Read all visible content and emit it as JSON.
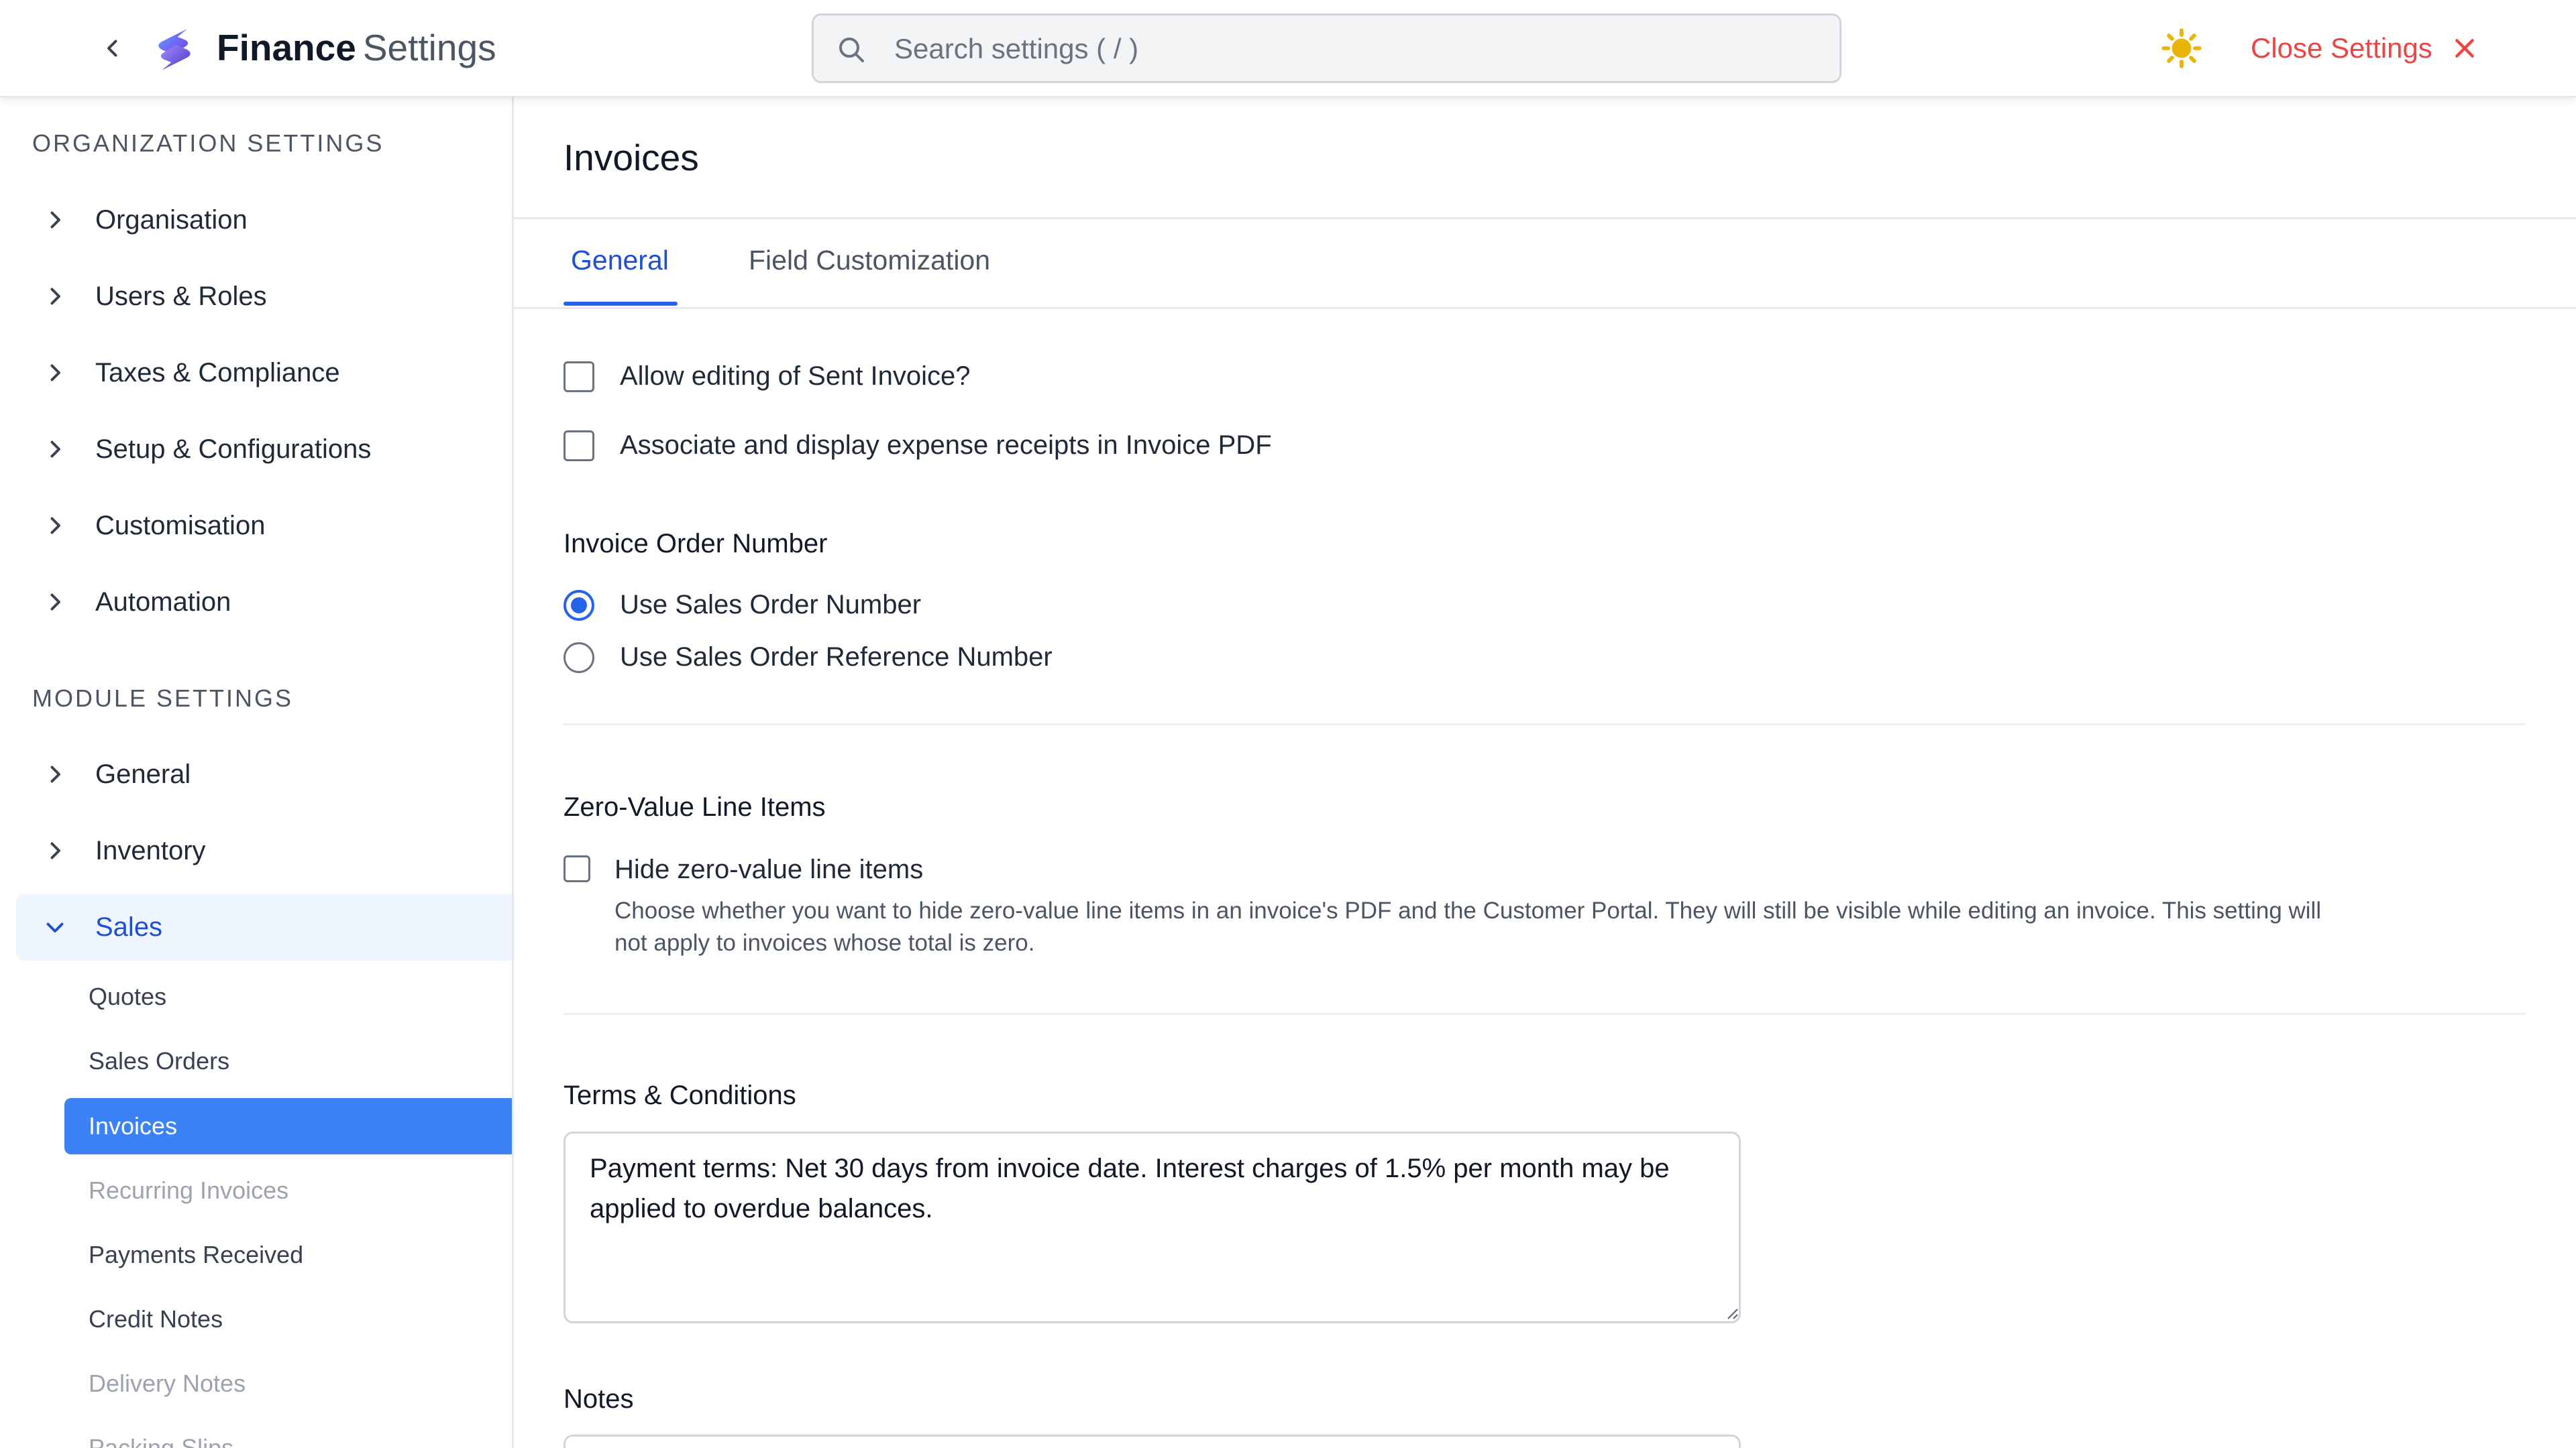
{
  "header": {
    "brand_strong": "Finance",
    "brand_light": "Settings",
    "search": {
      "placeholder": "Search settings ( / )",
      "value": ""
    },
    "close_label": "Close Settings",
    "icons": {
      "back": "chevron-left-icon",
      "logo": "app-logo-icon",
      "search": "search-icon",
      "theme": "sun-icon",
      "close": "close-icon"
    },
    "colors": {
      "close": "#ef4444",
      "sun": "#eab308",
      "accent": "#2563eb"
    }
  },
  "sidebar": {
    "org_section_label": "ORGANIZATION SETTINGS",
    "org_items": [
      {
        "label": "Organisation"
      },
      {
        "label": "Users & Roles"
      },
      {
        "label": "Taxes & Compliance"
      },
      {
        "label": "Setup & Configurations"
      },
      {
        "label": "Customisation"
      },
      {
        "label": "Automation"
      }
    ],
    "module_section_label": "MODULE SETTINGS",
    "module_items": [
      {
        "label": "General"
      },
      {
        "label": "Inventory"
      },
      {
        "label": "Sales",
        "expanded": true
      }
    ],
    "sales_sub_items": [
      {
        "label": "Quotes"
      },
      {
        "label": "Sales Orders"
      },
      {
        "label": "Invoices",
        "active": true
      },
      {
        "label": "Recurring Invoices",
        "disabled": true
      },
      {
        "label": "Payments Received"
      },
      {
        "label": "Credit Notes"
      },
      {
        "label": "Delivery Notes",
        "disabled": true
      },
      {
        "label": "Packing Slips",
        "disabled": true
      }
    ],
    "colors": {
      "active_bg": "#3b82f6",
      "expanded_bg": "#eff6ff"
    }
  },
  "main": {
    "page_title": "Invoices",
    "tabs": [
      {
        "label": "General",
        "active": true
      },
      {
        "label": "Field Customization"
      }
    ],
    "options": {
      "allow_editing_sent": {
        "label": "Allow editing of Sent Invoice?",
        "checked": false
      },
      "attach_receipts": {
        "label": "Associate and display expense receipts in Invoice PDF",
        "checked": false
      }
    },
    "invoice_order_number": {
      "title": "Invoice Order Number",
      "choices": [
        {
          "label": "Use Sales Order Number",
          "selected": true
        },
        {
          "label": "Use Sales Order Reference Number",
          "selected": false
        }
      ]
    },
    "zero_value": {
      "title": "Zero-Value Line Items",
      "checkbox_label": "Hide zero-value line items",
      "checked": false,
      "help": "Choose whether you want to hide zero-value line items in an invoice's PDF and the Customer Portal. They will still be visible while editing an invoice. This setting will not apply to invoices whose total is zero."
    },
    "terms": {
      "title": "Terms & Conditions",
      "value": "Payment terms: Net 30 days from invoice date. Interest charges of 1.5% per month may be applied to overdue balances."
    },
    "notes": {
      "title": "Notes",
      "value": ""
    }
  }
}
